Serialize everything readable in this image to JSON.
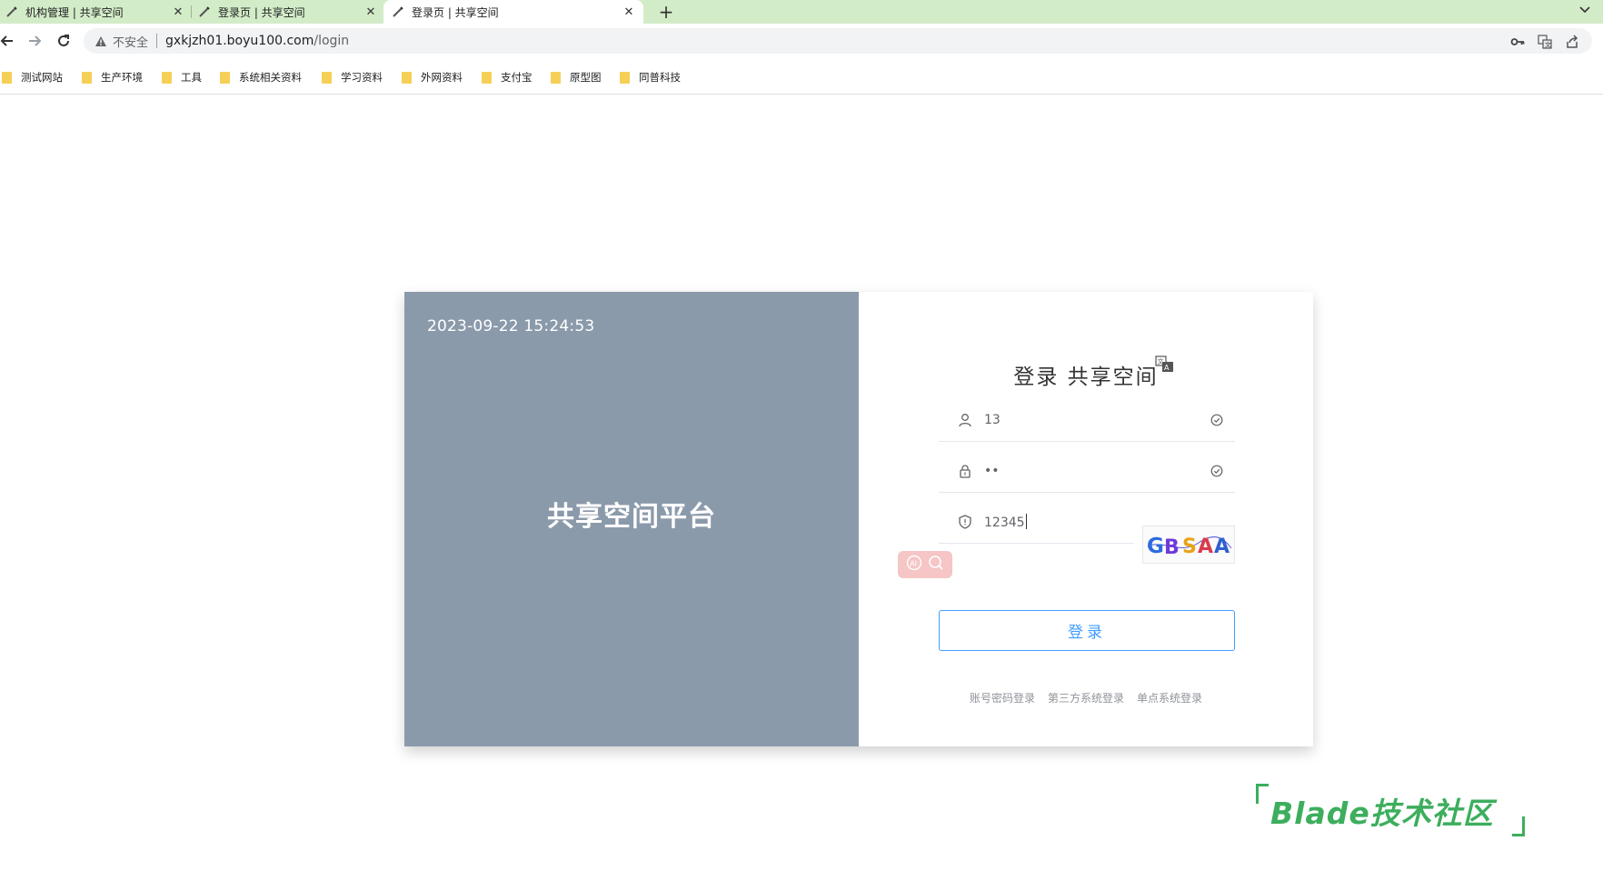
{
  "browser": {
    "tabs": [
      {
        "title": "机构管理 | 共享空间",
        "close": "✕",
        "active": false
      },
      {
        "title": "登录页 | 共享空间",
        "close": "✕",
        "active": false
      },
      {
        "title": "登录页 | 共享空间",
        "close": "✕",
        "active": true
      }
    ],
    "new_tab": "+",
    "tab_menu": "⌄",
    "security_label": "不安全",
    "url_host": "gxkjzh01.boyu100.com",
    "url_path": "/login",
    "bookmarks": [
      "测试网站",
      "生产环境",
      "工具",
      "系统相关资料",
      "学习资料",
      "外网资料",
      "支付宝",
      "原型图",
      "同普科技"
    ]
  },
  "login": {
    "datetime": "2023-09-22 15:24:53",
    "platform_name": "共享空间平台",
    "title": "登录 共享空间",
    "username_value": "13",
    "password_value": "••",
    "code_value": "12345",
    "captcha_text": "GBSAA",
    "submit_label": "登录",
    "links": [
      "账号密码登录",
      "第三方系统登录",
      "单点系统登录"
    ]
  },
  "watermark": {
    "text": "Blade技术社区"
  },
  "colors": {
    "tabstrip": "#d3ecc8",
    "left_panel": "#8b9aab",
    "primary": "#409eff",
    "watermark": "#3cae5d"
  }
}
